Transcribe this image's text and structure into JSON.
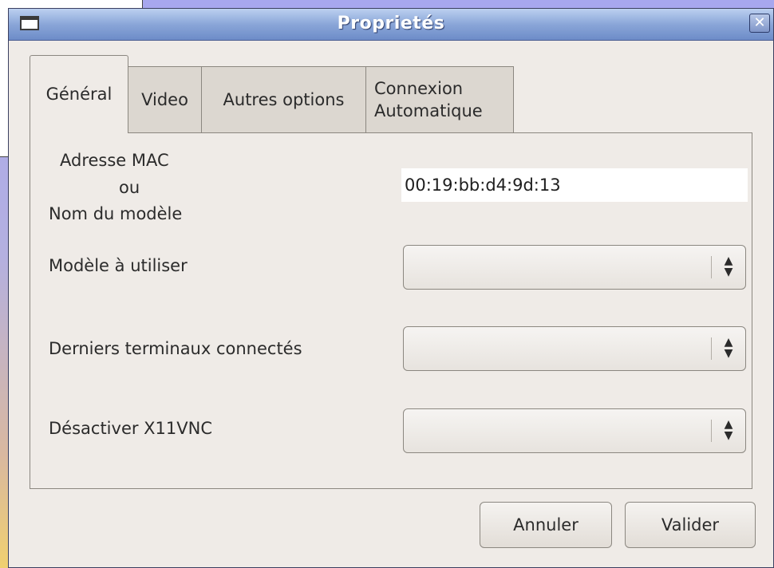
{
  "window": {
    "title": "Proprietés",
    "close_glyph": "✕"
  },
  "tabs": [
    {
      "label": "Général",
      "active": true
    },
    {
      "label": "Video",
      "active": false
    },
    {
      "label": "Autres options",
      "active": false
    },
    {
      "label_line1": "Connexion",
      "label_line2": "Automatique",
      "active": false
    }
  ],
  "general": {
    "mac_label_line1": "Adresse MAC",
    "mac_label_line2": "ou",
    "mac_label_line3": "Nom du modèle",
    "mac_value": "00:19:bb:d4:9d:13",
    "model_label": "Modèle à utiliser",
    "model_value": "",
    "last_terminals_label": "Derniers terminaux connectés",
    "last_terminals_value": "",
    "disable_x11vnc_label": "Désactiver X11VNC",
    "disable_x11vnc_value": ""
  },
  "buttons": {
    "cancel_label": "Annuler",
    "ok_label": "Valider"
  },
  "icons": {
    "window_icon": "window-icon",
    "close_icon": "close-icon",
    "combo_arrows": "updown-arrows-icon"
  }
}
